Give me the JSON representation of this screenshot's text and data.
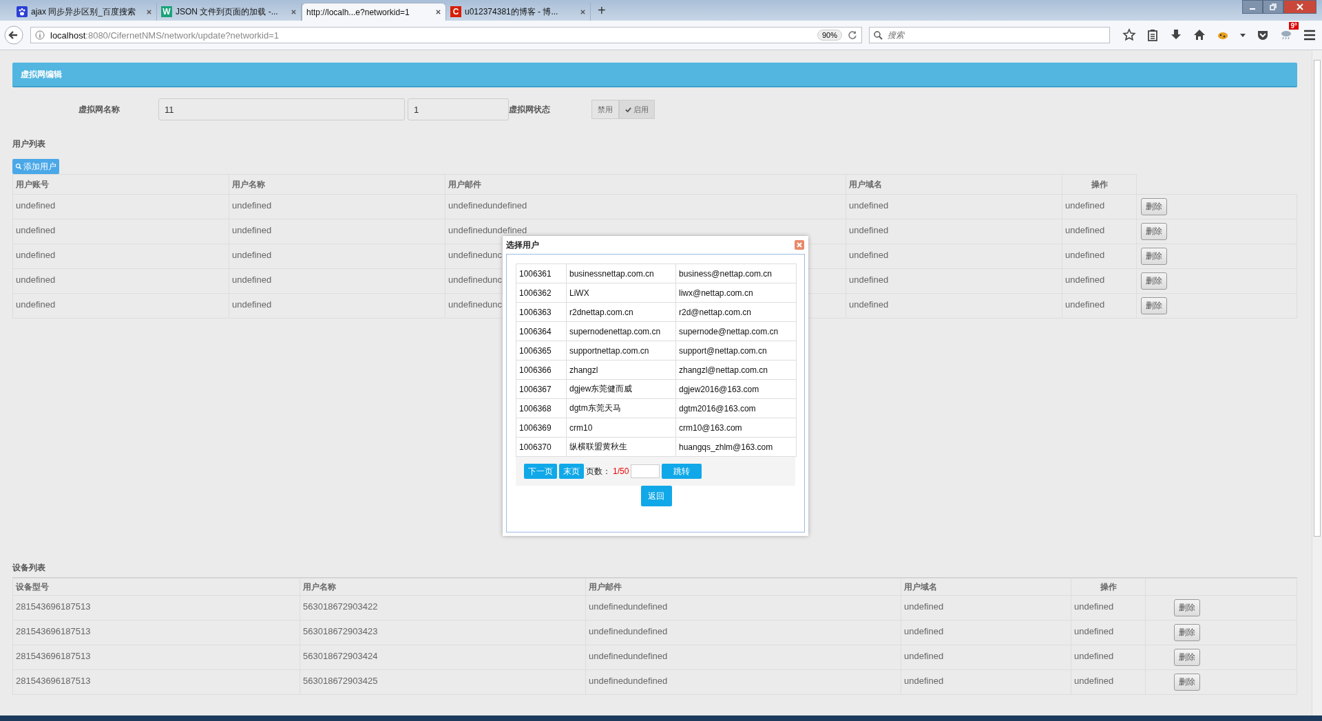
{
  "browser": {
    "tabs": [
      {
        "title": "ajax 同步异步区别_百度搜索",
        "selected": false,
        "kind": "paw"
      },
      {
        "title": "JSON 文件到页面的加载 -...",
        "selected": false,
        "kind": "letter",
        "icon_text": "W",
        "color": "#1aa37a"
      },
      {
        "title": "http://localh...e?networkid=1",
        "selected": true,
        "kind": "none"
      },
      {
        "title": "u012374381的博客 - 博...",
        "selected": false,
        "kind": "letter",
        "icon_text": "C",
        "color": "#d81e06"
      }
    ],
    "new_tab": "+",
    "url_host": "localhost",
    "url_rest": ":8080/CifernetNMS/network/update?networkid=1",
    "zoom": "90%",
    "search": {
      "placeholder": "搜索"
    },
    "badge": "9°"
  },
  "panel": {
    "title": "虚拟网编辑"
  },
  "form": {
    "name_label": "虚拟网名称",
    "name_value": "11",
    "second_value": "1",
    "status_label": "虚拟网状态",
    "status_options": [
      {
        "label": "禁用",
        "checked": false
      },
      {
        "label": "启用",
        "checked": true
      }
    ]
  },
  "user_list": {
    "heading": "用户列表",
    "add_button": "添加用户",
    "columns": [
      "用户账号",
      "用户名称",
      "用户邮件",
      "用户域名",
      "操作"
    ],
    "rows": [
      {
        "cells": [
          "undefined",
          "undefined",
          "undefinedundefined",
          "undefined",
          "undefined"
        ],
        "action": "删除"
      },
      {
        "cells": [
          "undefined",
          "undefined",
          "undefinedundefined",
          "undefined",
          "undefined"
        ],
        "action": "删除"
      },
      {
        "cells": [
          "undefined",
          "undefined",
          "undefinedunc",
          "undefined",
          "undefined"
        ],
        "action": "删除"
      },
      {
        "cells": [
          "undefined",
          "undefined",
          "undefinedunc",
          "undefined",
          "undefined"
        ],
        "action": "删除"
      },
      {
        "cells": [
          "undefined",
          "undefined",
          "undefinedunc",
          "undefined",
          "undefined"
        ],
        "action": "删除"
      }
    ]
  },
  "dialog": {
    "title": "选择用户",
    "rows": [
      [
        "1006361",
        "businessnettap.com.cn",
        "business@nettap.com.cn"
      ],
      [
        "1006362",
        "LiWX",
        "liwx@nettap.com.cn"
      ],
      [
        "1006363",
        "r2dnettap.com.cn",
        "r2d@nettap.com.cn"
      ],
      [
        "1006364",
        "supernodenettap.com.cn",
        "supernode@nettap.com.cn"
      ],
      [
        "1006365",
        "supportnettap.com.cn",
        "support@nettap.com.cn"
      ],
      [
        "1006366",
        "zhangzl",
        "zhangzl@nettap.com.cn"
      ],
      [
        "1006367",
        "dgjew东莞健而威",
        "dgjew2016@163.com"
      ],
      [
        "1006368",
        "dgtm东莞天马",
        "dgtm2016@163.com"
      ],
      [
        "1006369",
        "crm10",
        "crm10@163.com"
      ],
      [
        "1006370",
        "纵横联盟黄秋生",
        "huangqs_zhlm@163.com"
      ]
    ],
    "next_button": "下一页",
    "last_button": "末页",
    "page_label": "页数：",
    "page_value": "1/50",
    "jump_button": "跳转",
    "back_button": "返回"
  },
  "device_list": {
    "heading": "设备列表",
    "columns": [
      "设备型号",
      "用户名称",
      "用户邮件",
      "用户域名",
      "操作"
    ],
    "rows": [
      {
        "cells": [
          "281543696187513",
          "563018672903422",
          "undefinedundefined",
          "undefined",
          "undefined"
        ],
        "action": "删除"
      },
      {
        "cells": [
          "281543696187513",
          "563018672903423",
          "undefinedundefined",
          "undefined",
          "undefined"
        ],
        "action": "删除"
      },
      {
        "cells": [
          "281543696187513",
          "563018672903424",
          "undefinedundefined",
          "undefined",
          "undefined"
        ],
        "action": "删除"
      },
      {
        "cells": [
          "281543696187513",
          "563018672903425",
          "undefinedundefined",
          "undefined",
          "undefined"
        ],
        "action": "删除"
      }
    ]
  }
}
